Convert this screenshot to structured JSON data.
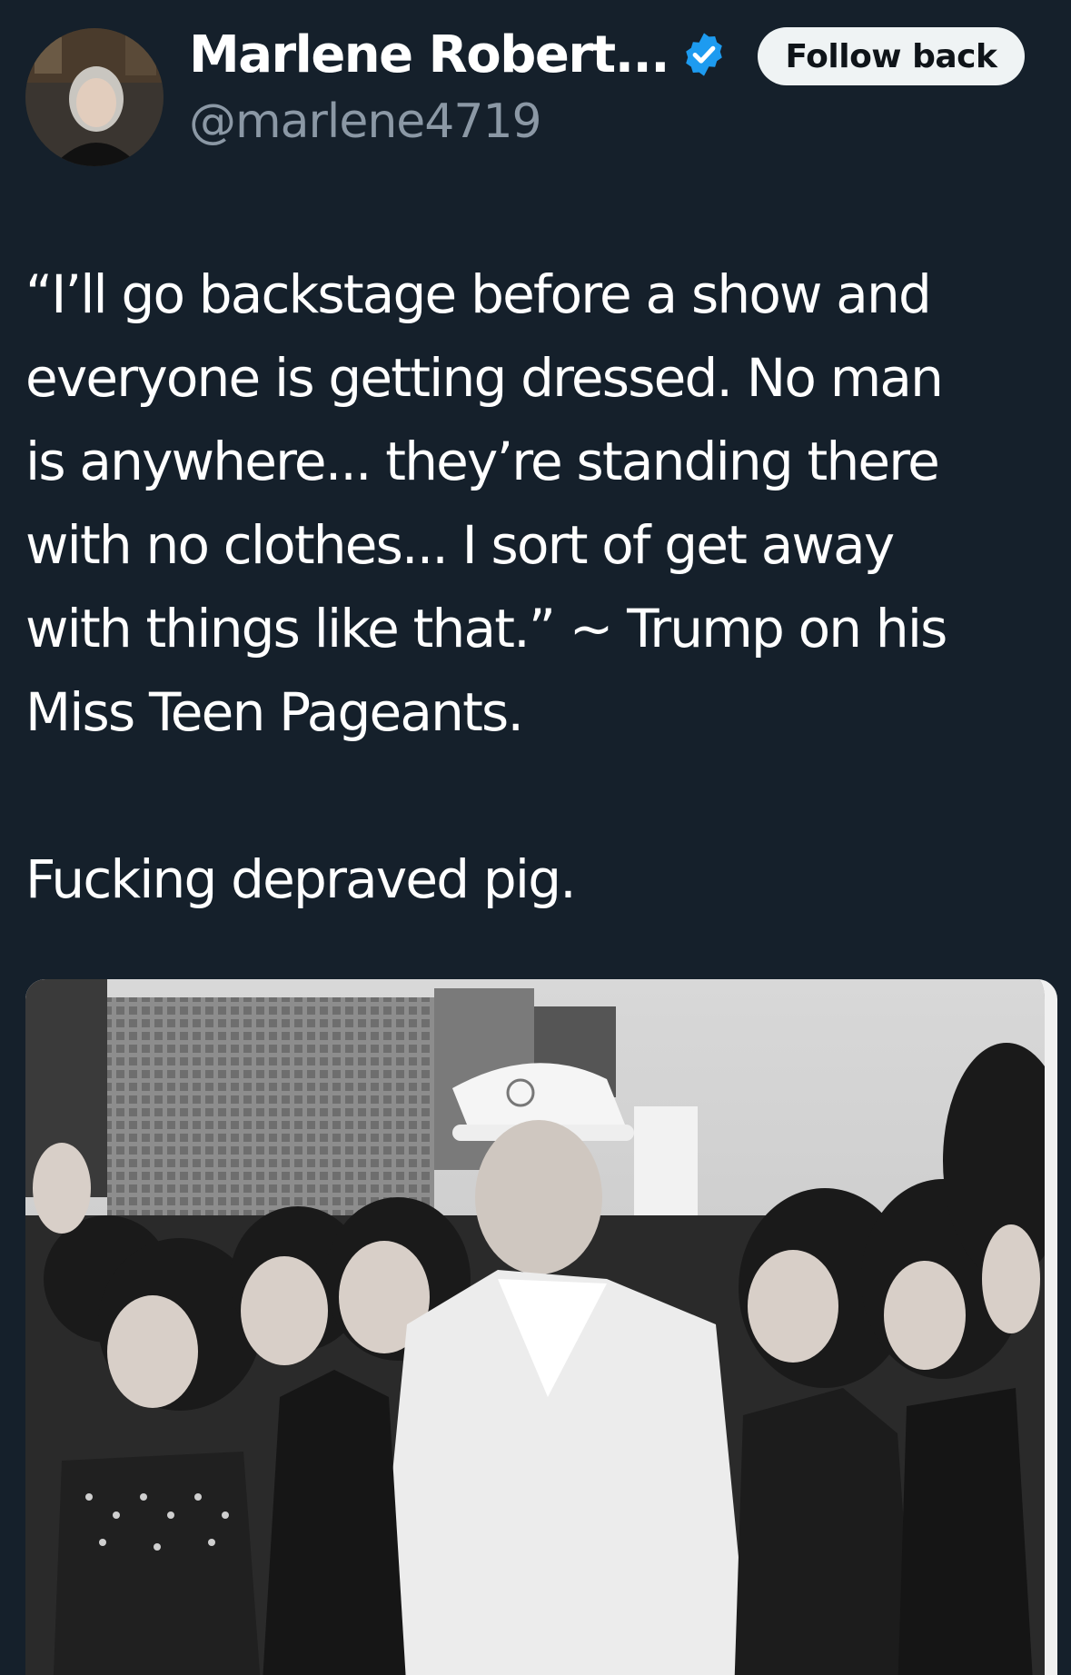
{
  "author": {
    "display_name": "Marlene Robert...",
    "handle": "@marlene4719",
    "verified": true,
    "avatar": "profile-photo"
  },
  "follow_button": {
    "label": "Follow back"
  },
  "tweet": {
    "lines": [
      "“I’ll go backstage before a show and",
      "everyone is getting dressed.   No man",
      "is anywhere... they’re standing there",
      "with no clothes... I sort of get away",
      "with things like that.” ~ Trump on his",
      "Miss Teen Pageants."
    ],
    "final_line": "Fucking depraved pig."
  },
  "media": {
    "type": "photo",
    "style": "black-and-white"
  },
  "colors": {
    "background": "#15202b",
    "text": "#ffffff",
    "secondary_text": "#8b98a5",
    "verified_blue": "#1d9bf0",
    "button_bg": "#eff3f4"
  }
}
